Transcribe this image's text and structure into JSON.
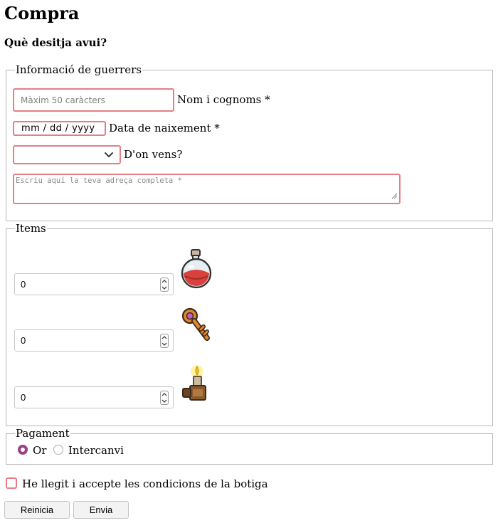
{
  "page": {
    "title": "Compra",
    "subtitle": "Què desitja avui?"
  },
  "info": {
    "legend": "Informació de guerrers",
    "name_placeholder": "Màxim 50 caràcters",
    "name_label": "Nom i cognoms *",
    "date_value": "mm / dd / yyyy",
    "date_label": "Data de naixement *",
    "origin_label": "D'on vens?",
    "origin_value": "",
    "address_placeholder": "Escriu aquí la teva adreça completa *"
  },
  "items": {
    "legend": "Items",
    "list": [
      {
        "value": "0",
        "icon": "red-potion-icon"
      },
      {
        "value": "0",
        "icon": "key-icon"
      },
      {
        "value": "0",
        "icon": "lantern-icon"
      }
    ]
  },
  "payment": {
    "legend": "Pagament",
    "options": [
      {
        "label": "Or",
        "selected": true
      },
      {
        "label": "Intercanvi",
        "selected": false
      }
    ]
  },
  "terms": {
    "label": "He llegit i accepte les condicions de la botiga",
    "checked": false
  },
  "buttons": {
    "reset": "Reinicia",
    "submit": "Envia"
  },
  "colors": {
    "invalid_border": "#e57f86",
    "radio_accent": "#9b3f86",
    "fieldset_border": "#b8b8b8"
  }
}
